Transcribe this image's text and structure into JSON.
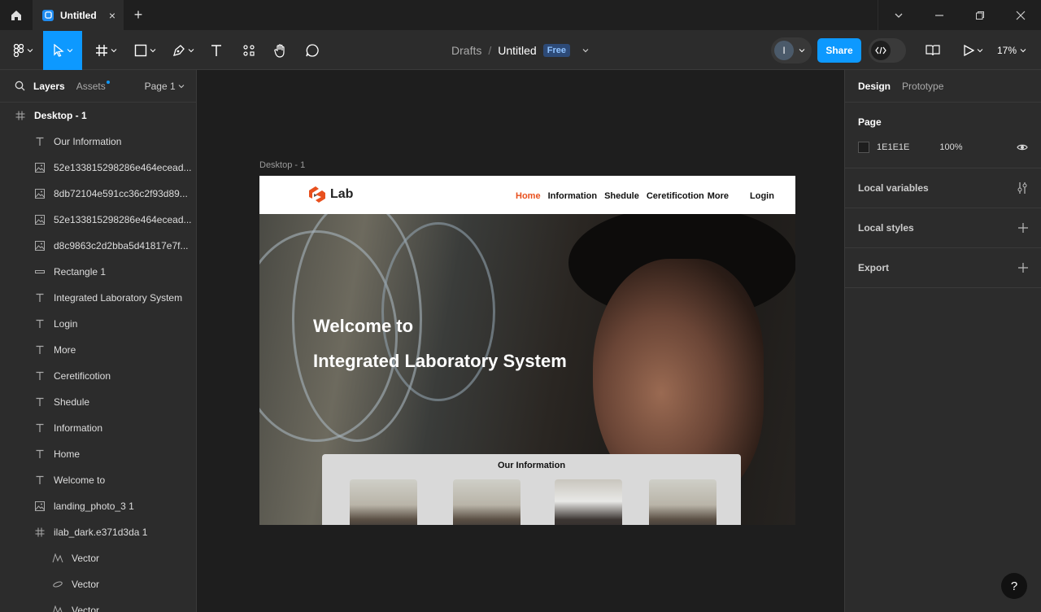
{
  "titlebar": {
    "tab_title": "Untitled",
    "home_icon": "home-icon",
    "close_tab": "×",
    "new_tab": "+"
  },
  "toolbar": {
    "breadcrumb_location": "Drafts",
    "breadcrumb_separator": "/",
    "file_title": "Untitled",
    "plan_badge": "Free",
    "avatar_initial": "I",
    "share_label": "Share",
    "zoom_level": "17%",
    "accent_color": "#0d99ff"
  },
  "left_panel": {
    "tab_layers": "Layers",
    "tab_assets": "Assets",
    "page_selector": "Page 1",
    "layers": [
      {
        "name": "Desktop - 1",
        "type": "frame",
        "level": "root"
      },
      {
        "name": "Our Information",
        "type": "text",
        "level": "l1"
      },
      {
        "name": "52e133815298286e464ecead...",
        "type": "image",
        "level": "l1"
      },
      {
        "name": "8db72104e591cc36c2f93d89...",
        "type": "image",
        "level": "l1"
      },
      {
        "name": "52e133815298286e464ecead...",
        "type": "image",
        "level": "l1"
      },
      {
        "name": "d8c9863c2d2bba5d41817e7f...",
        "type": "image",
        "level": "l1"
      },
      {
        "name": "Rectangle 1",
        "type": "rect",
        "level": "l1"
      },
      {
        "name": "Integrated Laboratory System",
        "type": "text",
        "level": "l1"
      },
      {
        "name": "Login",
        "type": "text",
        "level": "l1"
      },
      {
        "name": "More",
        "type": "text",
        "level": "l1"
      },
      {
        "name": "Ceretificotion",
        "type": "text",
        "level": "l1"
      },
      {
        "name": "Shedule",
        "type": "text",
        "level": "l1"
      },
      {
        "name": "Information",
        "type": "text",
        "level": "l1"
      },
      {
        "name": "Home",
        "type": "text",
        "level": "l1"
      },
      {
        "name": "Welcome to",
        "type": "text",
        "level": "l1"
      },
      {
        "name": "landing_photo_3 1",
        "type": "image",
        "level": "l1"
      },
      {
        "name": "ilab_dark.e371d3da 1",
        "type": "frame",
        "level": "l1"
      },
      {
        "name": "Vector",
        "type": "vector",
        "level": "l2"
      },
      {
        "name": "Vector",
        "type": "ellipse",
        "level": "l2"
      },
      {
        "name": "Vector",
        "type": "vector",
        "level": "l2"
      }
    ]
  },
  "canvas": {
    "frame_label": "Desktop - 1",
    "site": {
      "logo_text": "Lab",
      "nav": [
        "Home",
        "Information",
        "Shedule",
        "Ceretificotion",
        "More"
      ],
      "login": "Login",
      "hero_line1": "Welcome to",
      "hero_line2": "Integrated Laboratory System",
      "info_title": "Our Information",
      "accent": "#e8501e"
    }
  },
  "right_panel": {
    "tab_design": "Design",
    "tab_prototype": "Prototype",
    "page_title": "Page",
    "page_color": "1E1E1E",
    "page_opacity": "100%",
    "local_variables": "Local variables",
    "local_styles": "Local styles",
    "export": "Export"
  },
  "help": "?"
}
